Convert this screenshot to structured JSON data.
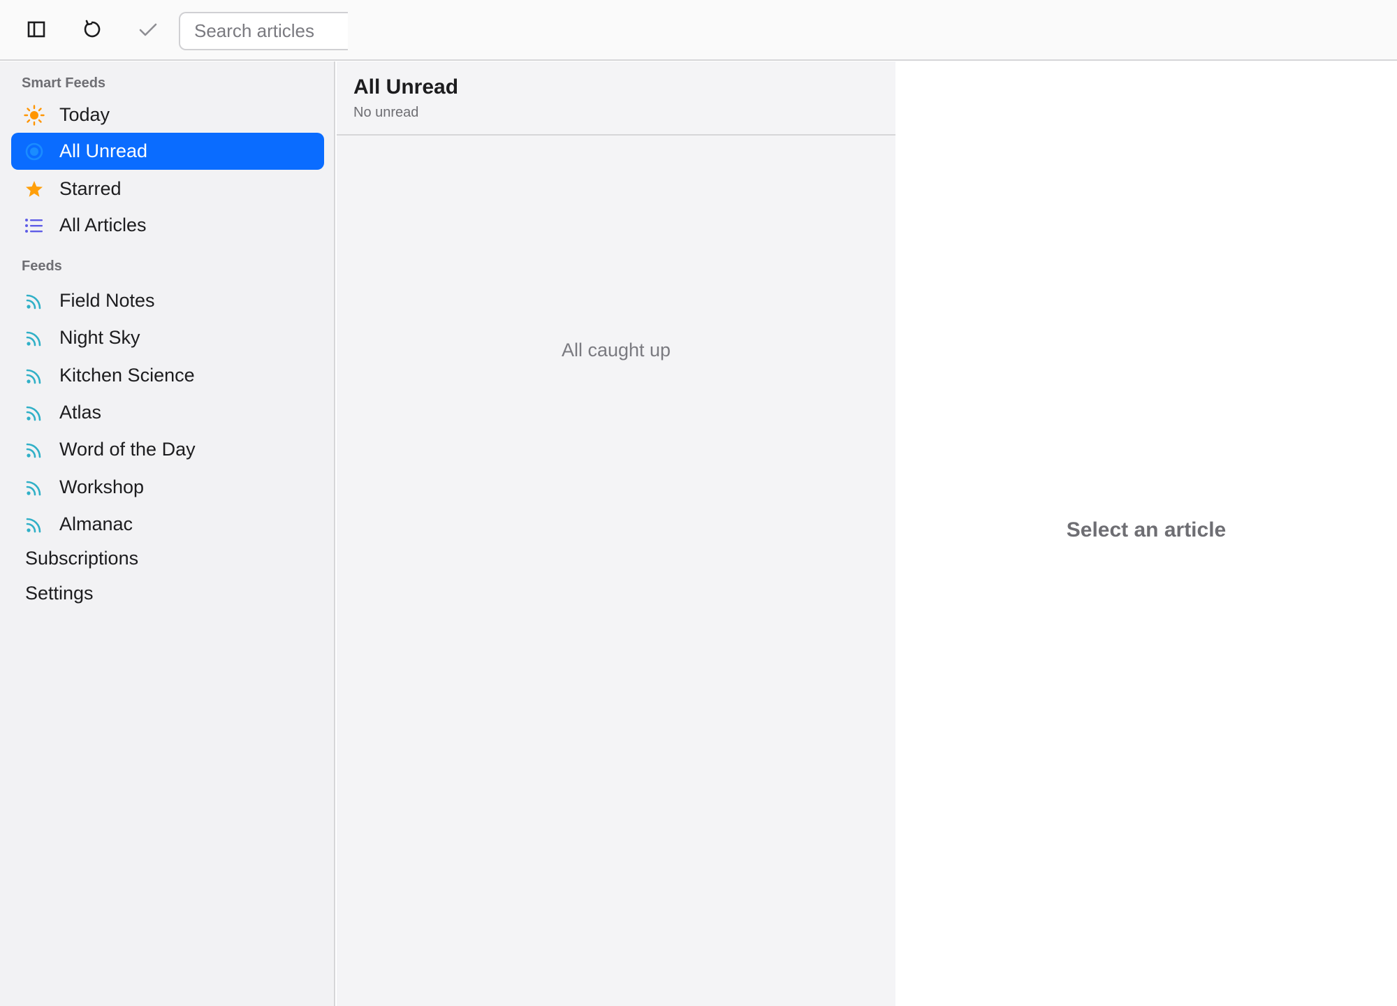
{
  "toolbar": {
    "sidebar_toggle_icon": "sidebar-icon",
    "refresh_icon": "refresh-icon",
    "mark_read_icon": "checkmark-icon",
    "search": {
      "placeholder": "Search articles",
      "value": ""
    }
  },
  "sidebar": {
    "smart_feeds_header": "Smart Feeds",
    "smart_feeds": [
      {
        "label": "Today",
        "icon": "sun-icon",
        "color": "#ff9500"
      },
      {
        "label": "All Unread",
        "icon": "unread-dot-icon",
        "color": "#0a84ff",
        "selected": true
      },
      {
        "label": "Starred",
        "icon": "star-icon",
        "color": "#ff9f0a"
      },
      {
        "label": "All Articles",
        "icon": "list-icon",
        "color": "#5e5ce6"
      }
    ],
    "feeds_header": "Feeds",
    "feeds": [
      {
        "label": "Field Notes",
        "icon": "rss-icon"
      },
      {
        "label": "Night Sky",
        "icon": "rss-icon"
      },
      {
        "label": "Kitchen Science",
        "icon": "rss-icon"
      },
      {
        "label": "Atlas",
        "icon": "rss-icon"
      },
      {
        "label": "Word of the Day",
        "icon": "rss-icon"
      },
      {
        "label": "Workshop",
        "icon": "rss-icon"
      },
      {
        "label": "Almanac",
        "icon": "rss-icon"
      }
    ],
    "feed_icon_color": "#30b0c7",
    "links": [
      {
        "label": "Subscriptions"
      },
      {
        "label": "Settings"
      }
    ],
    "accent_color": "#0a6cff"
  },
  "list": {
    "title": "All Unread",
    "subtitle": "No unread",
    "empty_message": "All caught up"
  },
  "detail": {
    "placeholder": "Select an article"
  }
}
